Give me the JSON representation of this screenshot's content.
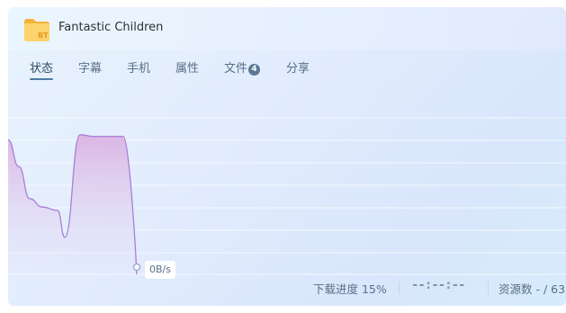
{
  "app": {
    "title": "Fantastic Children",
    "folder_badge": "BT"
  },
  "tabs": [
    {
      "label": "状态",
      "active": true
    },
    {
      "label": "字幕",
      "active": false
    },
    {
      "label": "手机",
      "active": false
    },
    {
      "label": "属性",
      "active": false
    },
    {
      "label": "文件",
      "active": false,
      "badge": "4"
    },
    {
      "label": "分享",
      "active": false
    }
  ],
  "speed": {
    "current": "0B/s",
    "colors": {
      "line": "#a97fd8",
      "fill_top": "#dbb2e3",
      "fill_bottom": "#e4e8fa"
    },
    "history_relative": [
      0.8,
      0.64,
      0.45,
      0.4,
      0.38,
      0.22,
      0.83,
      0.82,
      0.82,
      0.82,
      0.0
    ]
  },
  "footer": {
    "progress_label": "下载进度 15%",
    "progress_percent": 15,
    "eta": "--:--:--",
    "sources_label": "资源数 - / 63"
  }
}
